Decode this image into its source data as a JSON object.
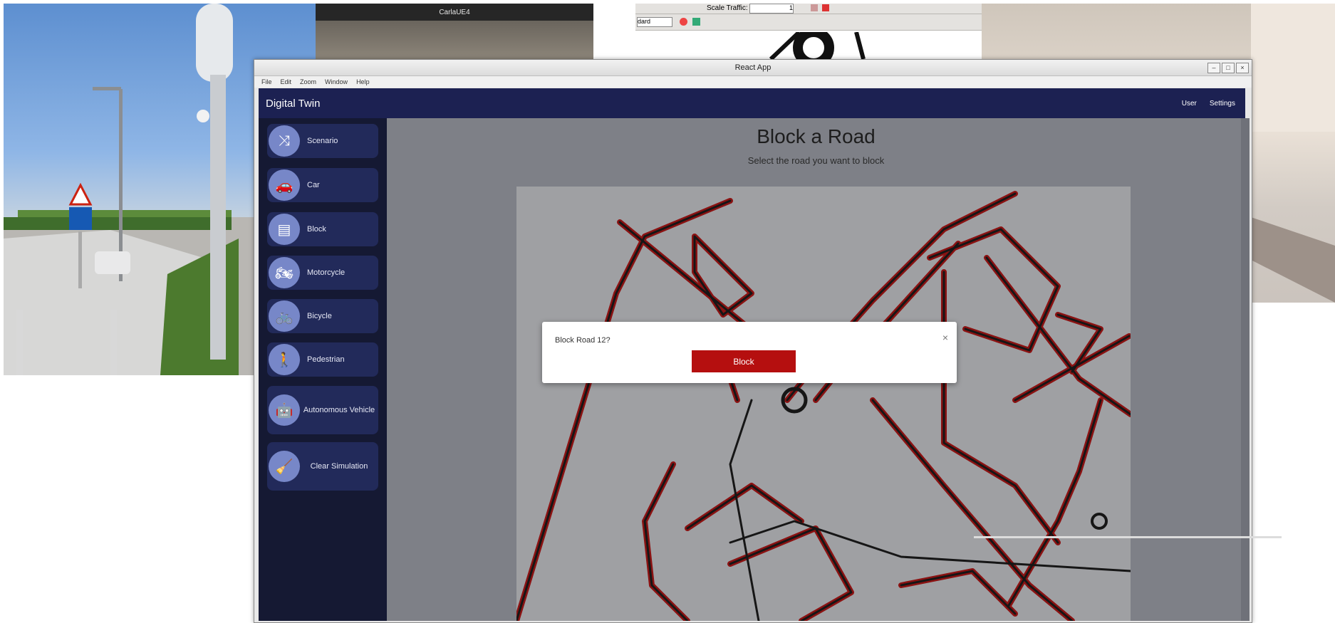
{
  "carla": {
    "title": "CarlaUE4"
  },
  "sumo": {
    "scale_label": "Scale Traffic:",
    "scale_value": "1",
    "combo_partial": "dard"
  },
  "app": {
    "window_title": "React App",
    "menu": [
      "File",
      "Edit",
      "Zoom",
      "Window",
      "Help"
    ],
    "brand": "Digital Twin",
    "nav_links": [
      "User",
      "Settings"
    ],
    "sidebar": [
      {
        "label": "Scenario",
        "icon": "shuffle-icon"
      },
      {
        "label": "Car",
        "icon": "car-icon"
      },
      {
        "label": "Block",
        "icon": "barrier-icon"
      },
      {
        "label": "Motorcycle",
        "icon": "motorcycle-icon"
      },
      {
        "label": "Bicycle",
        "icon": "bicycle-icon"
      },
      {
        "label": "Pedestrian",
        "icon": "pedestrian-icon"
      },
      {
        "label": "Autonomous Vehicle",
        "icon": "robot-icon"
      },
      {
        "label": "Clear Simulation",
        "icon": "broom-icon"
      }
    ],
    "page_title": "Block a Road",
    "page_subtitle": "Select the road you want to block",
    "dialog": {
      "message": "Block Road 12?",
      "button": "Block",
      "close": "×"
    }
  },
  "colors": {
    "navbar": "#1c2152",
    "sidebar": "#151933",
    "accent_red": "#b50f0f",
    "road_red": "#8a1212"
  }
}
